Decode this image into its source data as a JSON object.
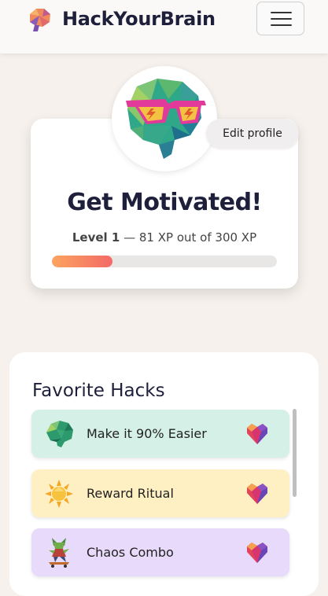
{
  "header": {
    "brand": "HackYourBrain",
    "logo_icon": "brain-logo-icon",
    "menu_icon": "hamburger-menu-icon"
  },
  "profile": {
    "avatar_icon": "brain-with-sunglasses-icon",
    "edit_label": "Edit profile",
    "title": "Get Motivated!",
    "level_label": "Level 1",
    "xp_text": "— 81 XP out of 300 XP",
    "xp_current": 81,
    "xp_max": 300,
    "progress_colors": [
      "#fca45f",
      "#f36a67"
    ]
  },
  "favorites": {
    "title": "Favorite Hacks",
    "items": [
      {
        "label": "Make it 90% Easier",
        "icon": "green-brain-icon",
        "bg": "#d5f0e6"
      },
      {
        "label": "Reward Ritual",
        "icon": "sun-icon",
        "bg": "#fff0c4"
      },
      {
        "label": "Chaos Combo",
        "icon": "goblin-skater-icon",
        "bg": "#e7dafa"
      }
    ],
    "heart_icon": "heart-icon"
  }
}
